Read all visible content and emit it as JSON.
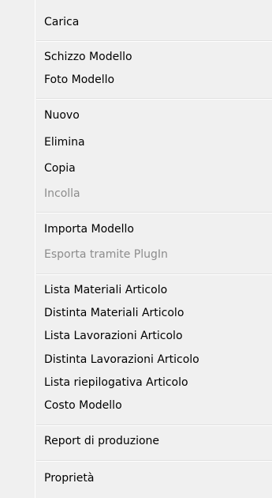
{
  "menu": {
    "items": [
      {
        "label": "Carica",
        "enabled": true
      },
      {
        "label": "Schizzo Modello",
        "enabled": true
      },
      {
        "label": "Foto Modello",
        "enabled": true
      },
      {
        "label": "Nuovo",
        "enabled": true
      },
      {
        "label": "Elimina",
        "enabled": true
      },
      {
        "label": "Copia",
        "enabled": true
      },
      {
        "label": "Incolla",
        "enabled": false
      },
      {
        "label": "Importa Modello",
        "enabled": true
      },
      {
        "label": "Esporta tramite PlugIn",
        "enabled": false
      },
      {
        "label": "Lista Materiali Articolo",
        "enabled": true
      },
      {
        "label": "Distinta Materiali Articolo",
        "enabled": true
      },
      {
        "label": "Lista Lavorazioni Articolo",
        "enabled": true
      },
      {
        "label": "Distinta Lavorazioni Articolo",
        "enabled": true
      },
      {
        "label": "Lista riepilogativa Articolo",
        "enabled": true
      },
      {
        "label": "Costo Modello",
        "enabled": true
      },
      {
        "label": "Report di produzione",
        "enabled": true
      },
      {
        "label": "Proprietà",
        "enabled": true
      }
    ]
  },
  "colors": {
    "menu_background": "#f0f0f0",
    "text": "#000000",
    "disabled_text": "#8c8c8c",
    "separator": "#e0e0e0"
  }
}
